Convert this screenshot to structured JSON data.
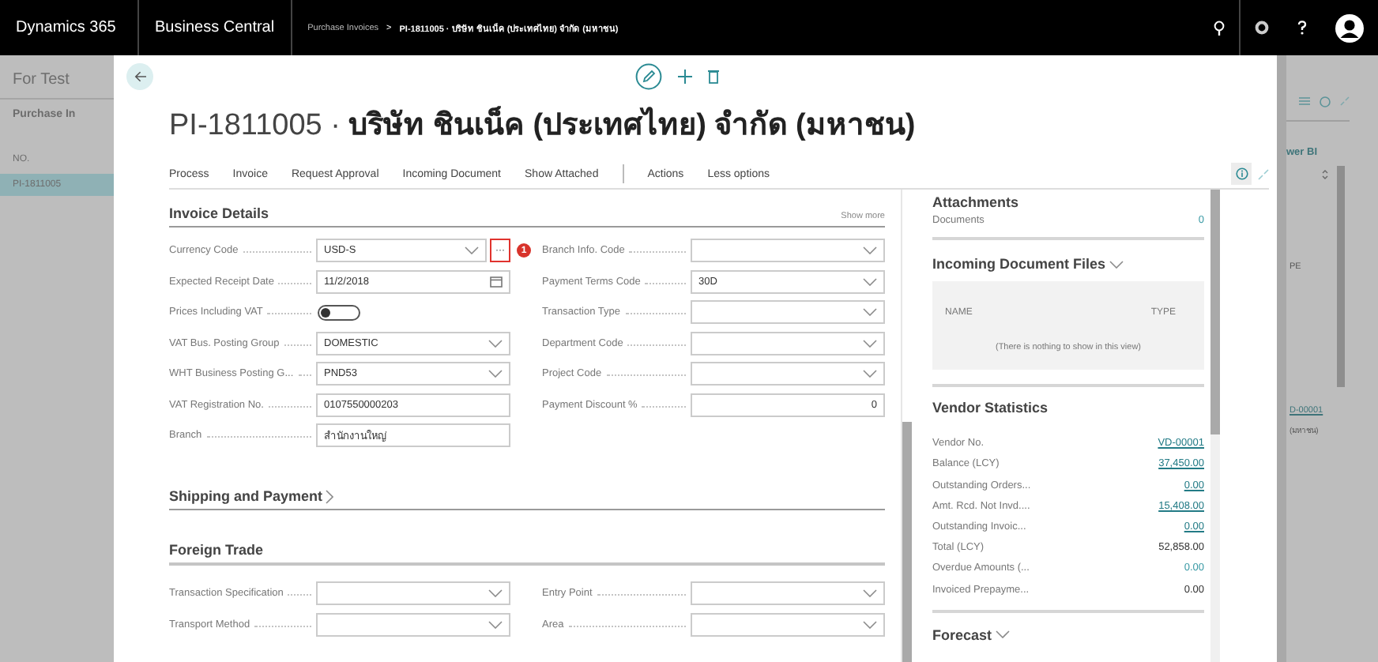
{
  "top_bar": {
    "product": "Dynamics 365",
    "app": "Business Central",
    "breadcrumb": [
      {
        "text": "Purchase Invoices"
      },
      {
        "text": "PI-1811005 · บริษัท ชินเน็ค (ประเทศไทย) จำกัด (มหาชน)"
      }
    ],
    "separator": ">"
  },
  "background_left": {
    "title": "For Test",
    "page": "Purchase In",
    "column": "NO.",
    "rows": [
      {
        "text": "PI-1811005",
        "selected": true
      }
    ]
  },
  "background_right": {
    "link": "wer BI",
    "column_fragment": "PE",
    "vendor_link": "D-00001",
    "name_fragment": "(มหาชน)"
  },
  "card": {
    "number": "PI-1811005",
    "separator": "·",
    "name": "บริษัท ชินเน็ค (ประเทศไทย) จำกัด (มหาชน)",
    "actions_primary": [
      {
        "label": "Process"
      },
      {
        "label": "Invoice"
      },
      {
        "label": "Request Approval"
      },
      {
        "label": "Incoming Document"
      },
      {
        "label": "Show Attached"
      }
    ],
    "actions_secondary": [
      {
        "label": "Actions"
      },
      {
        "label": "Less options"
      }
    ],
    "invoice_details": {
      "title": "Invoice Details",
      "show_more": "Show more",
      "fields_left": [
        {
          "label": "Currency Code",
          "kind": "dropdown",
          "value": "USD-S",
          "lookup_button": "···",
          "highlighted": true,
          "badge": "1"
        },
        {
          "label": "Expected Receipt Date",
          "kind": "date",
          "value": "11/2/2018"
        },
        {
          "label": "Prices Including VAT",
          "kind": "toggle",
          "on": false
        },
        {
          "label": "VAT Bus. Posting Group",
          "kind": "dropdown",
          "value": "DOMESTIC"
        },
        {
          "label": "WHT Business Posting G...",
          "kind": "dropdown",
          "value": "PND53"
        },
        {
          "label": "VAT Registration No.",
          "kind": "text",
          "value": "0107550000203"
        },
        {
          "label": "Branch",
          "kind": "text",
          "value": "สำนักงานใหญ่"
        }
      ],
      "fields_right": [
        {
          "label": "Branch Info. Code",
          "kind": "dropdown"
        },
        {
          "label": "Payment Terms Code",
          "kind": "dropdown",
          "value": "30D"
        },
        {
          "label": "Transaction Type",
          "kind": "dropdown"
        },
        {
          "label": "Department Code",
          "kind": "dropdown"
        },
        {
          "label": "Project Code",
          "kind": "dropdown"
        },
        {
          "label": "Payment Discount %",
          "kind": "number",
          "value": "0"
        }
      ]
    },
    "shipping": {
      "title": "Shipping and Payment",
      "expanded": false
    },
    "foreign_trade": {
      "title": "Foreign Trade",
      "fields_left": [
        {
          "label": "Transaction Specification",
          "kind": "dropdown"
        },
        {
          "label": "Transport Method",
          "kind": "dropdown"
        }
      ],
      "fields_right": [
        {
          "label": "Entry Point",
          "kind": "dropdown"
        },
        {
          "label": "Area",
          "kind": "dropdown"
        }
      ]
    }
  },
  "factbox": {
    "attachments": {
      "title": "Attachments",
      "rows": [
        {
          "label": "Documents",
          "value": "0",
          "kind": "accent"
        }
      ]
    },
    "incoming_files": {
      "title": "Incoming Document Files",
      "expanded": true,
      "columns": [
        "NAME",
        "TYPE"
      ],
      "empty_message": "(There is nothing to show in this view)"
    },
    "vendor_statistics": {
      "title": "Vendor Statistics",
      "rows": [
        {
          "label": "Vendor No.",
          "value": "VD-00001",
          "kind": "link"
        },
        {
          "label": "Balance (LCY)",
          "value": "37,450.00",
          "kind": "link"
        },
        {
          "label": "Outstanding Orders...",
          "value": "0.00",
          "kind": "link"
        },
        {
          "label": "Amt. Rcd. Not Invd....",
          "value": "15,408.00",
          "kind": "link"
        },
        {
          "label": "Outstanding Invoic...",
          "value": "0.00",
          "kind": "link"
        },
        {
          "label": "Total (LCY)",
          "value": "52,858.00",
          "kind": "plain"
        },
        {
          "label": "Overdue Amounts (...",
          "value": "0.00",
          "kind": "accent"
        },
        {
          "label": "Invoiced Prepayme...",
          "value": "0.00",
          "kind": "plain"
        }
      ]
    },
    "forecast": {
      "title": "Forecast",
      "expanded": true
    }
  }
}
